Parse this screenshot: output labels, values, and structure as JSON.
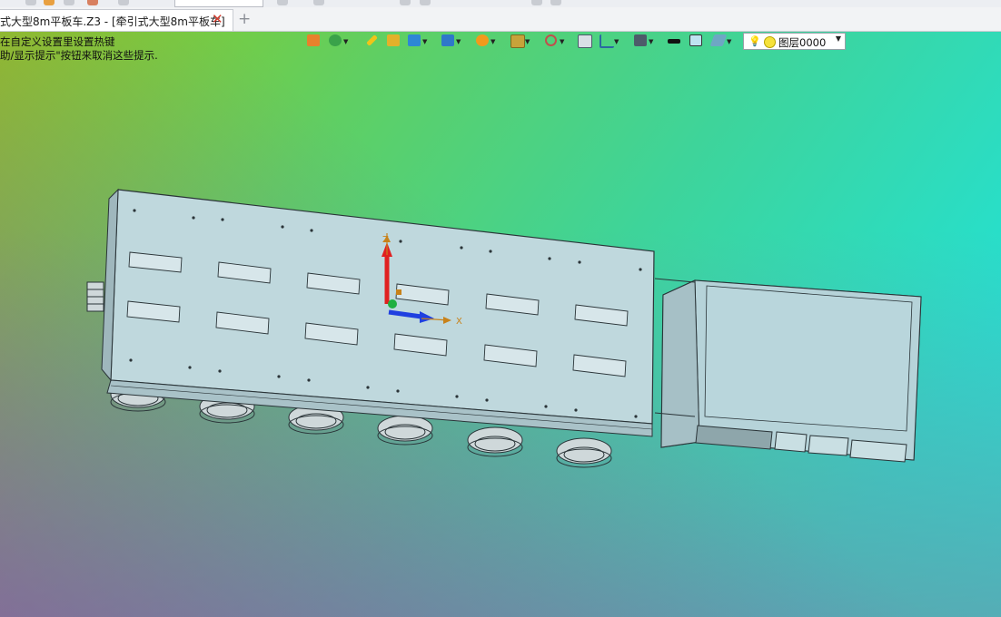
{
  "document_tab": {
    "title": "式大型8m平板车.Z3 - [牵引式大型8m平板车]",
    "close_icon": "close-icon",
    "new_tab_symbol": "+"
  },
  "viewport": {
    "hint_line1": "在自定义设置里设置热键",
    "hint_line2": "助/显示提示\"按钮来取消这些提示.",
    "background_colors": [
      "#8fc920",
      "#25e0d0",
      "#9a3cb0"
    ],
    "toolbar_icons": [
      "exit-sketch-icon",
      "pick-filter-icon",
      "pencil-icon",
      "solid-box-icon",
      "shaded-cube-icon",
      "view-cube-icon",
      "render-mode-icon",
      "display-filter-icon",
      "snap-icon",
      "datum-plane-icon",
      "dimension-icon",
      "monitor-icon",
      "line-color-swatch-icon",
      "fill-color-swatch-icon",
      "layer-stack-icon"
    ],
    "layer_combo": {
      "value": "图层0000"
    },
    "triad_labels": {
      "x": "X",
      "z": "Z"
    },
    "model": {
      "trailer_color": "#bfd8dd",
      "outline_color": "#2a3438"
    }
  }
}
